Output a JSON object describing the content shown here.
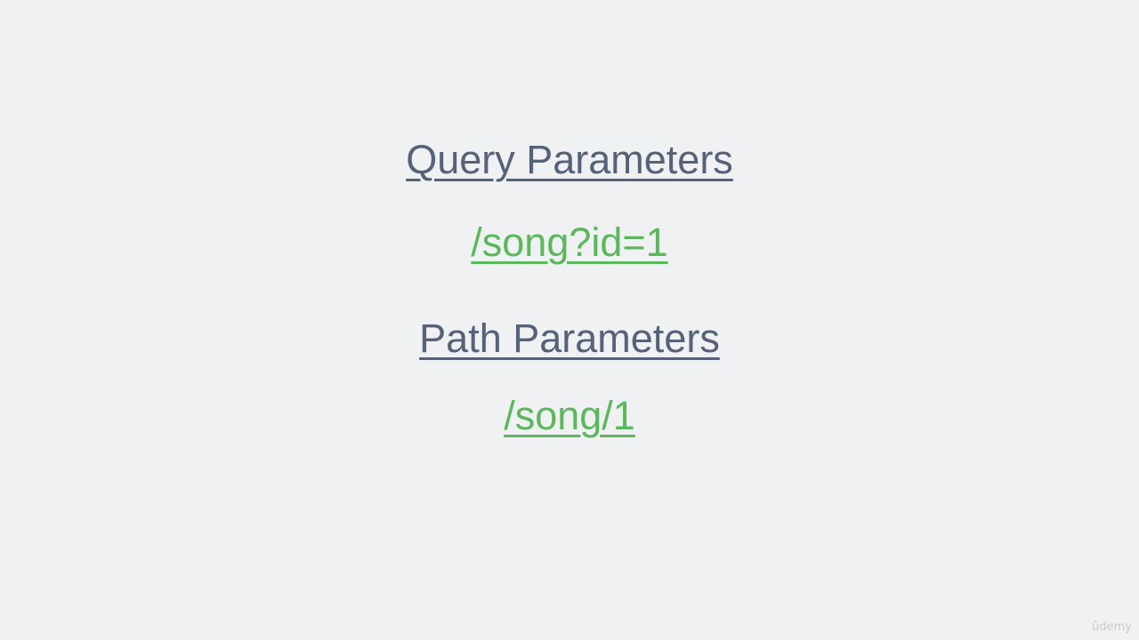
{
  "slide": {
    "query_heading": "Query Parameters",
    "query_example": "/song?id=1",
    "path_heading": "Path Parameters",
    "path_example": "/song/1"
  },
  "watermark": "ûdemy",
  "colors": {
    "background": "#f0f1f3",
    "heading": "#56617a",
    "example": "#5cb85c"
  }
}
